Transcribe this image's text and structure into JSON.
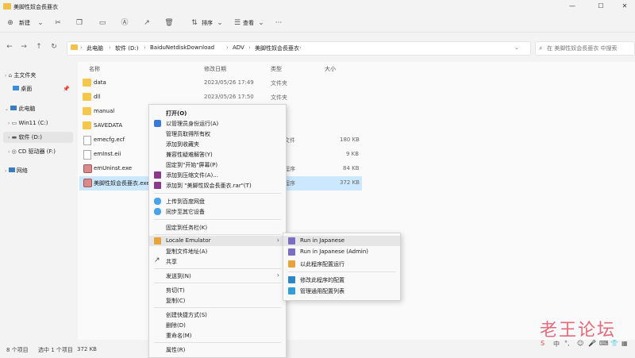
{
  "window": {
    "title": "美脚性奴会長亜衣"
  },
  "toolbar": {
    "new_label": "新建",
    "sort_label": "排序",
    "view_label": "查看"
  },
  "address": {
    "crumbs": [
      "此电脑",
      "软件 (D:)",
      "BaiduNetdiskDownload",
      "ADV",
      "美脚性奴会長亜衣"
    ]
  },
  "search": {
    "placeholder": "在 美脚性奴会長亜衣 中搜索"
  },
  "sidebar": {
    "items": [
      {
        "label": "主文件夹"
      },
      {
        "label": "桌面"
      },
      {
        "label": "此电脑"
      },
      {
        "label": "Win11 (C:)"
      },
      {
        "label": "软件 (D:)"
      },
      {
        "label": "CD 驱动器 (F:)"
      },
      {
        "label": "网络"
      }
    ]
  },
  "columns": {
    "name": "名称",
    "modified": "修改日期",
    "type": "类型",
    "size": "大小"
  },
  "files": [
    {
      "name": "data",
      "date": "2023/05/26 17:49",
      "type": "文件夹",
      "size": ""
    },
    {
      "name": "dll",
      "date": "2023/05/26 17:50",
      "type": "文件夹",
      "size": ""
    },
    {
      "name": "manual",
      "date": "",
      "type": "",
      "size": ""
    },
    {
      "name": "SAVEDATA",
      "date": "",
      "type": "",
      "size": ""
    },
    {
      "name": "emecfg.ecf",
      "date": "",
      "type": "文件",
      "size": "180 KB"
    },
    {
      "name": "emInst.eii",
      "date": "",
      "type": "",
      "size": "9 KB"
    },
    {
      "name": "emUninst.exe",
      "date": "",
      "type": "程序",
      "size": "84 KB"
    },
    {
      "name": "美脚性奴会長亜衣.exe",
      "date": "",
      "type": "程序",
      "size": "372 KB"
    }
  ],
  "context_menu": {
    "items": [
      "打开(O)",
      "以管理员身份运行(A)",
      "管理员取得所有权",
      "添加到收藏夹",
      "兼容性疑难解答(Y)",
      "固定到\"开始\"屏幕(P)",
      "添加到压缩文件(A)...",
      "添加到 \"美脚性奴会長亜衣.rar\"(T)",
      "上传到百度网盘",
      "同步至其它设备",
      "固定到任务栏(K)",
      "Locale Emulator",
      "复制文件地址(A)",
      "共享",
      "发送到(N)",
      "剪切(T)",
      "复制(C)",
      "创建快捷方式(S)",
      "删除(D)",
      "重命名(M)",
      "属性(R)"
    ]
  },
  "submenu": {
    "items": [
      "Run in Japanese",
      "Run in Japanese (Admin)",
      "以此程序配置运行",
      "修改此程序的配置",
      "管理通用配置列表"
    ]
  },
  "status": {
    "count": "8 个项目",
    "selected": "选中 1 个项目",
    "size": "372 KB"
  },
  "watermark": {
    "text": "老王论坛"
  },
  "colors": {
    "accent": "#0067c0",
    "selection": "#cce8ff",
    "folder": "#f3c84d"
  }
}
